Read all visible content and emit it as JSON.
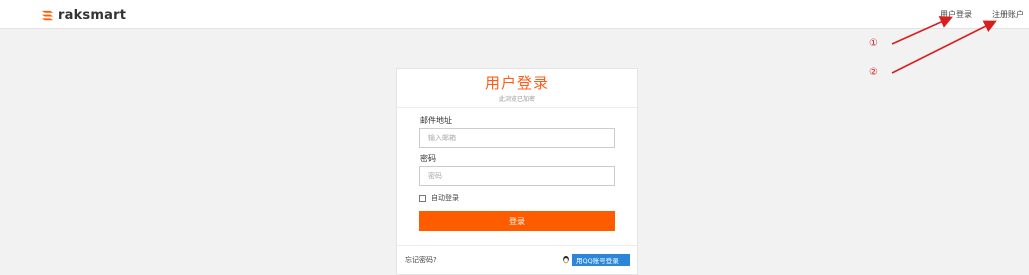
{
  "header": {
    "brand": "raksmart",
    "nav": {
      "login": "用户登录",
      "register": "注册账户"
    }
  },
  "annotations": {
    "marker1": "①",
    "marker2": "②"
  },
  "login_card": {
    "title": "用户登录",
    "subtitle": "此浏览已加密",
    "email_label": "邮件地址",
    "email_placeholder": "输入邮箱",
    "password_label": "密码",
    "password_placeholder": "密码",
    "remember_label": "自动登录",
    "submit_label": "登录",
    "forgot_label": "忘记密码?",
    "qq_login_label": "用QQ账号登录"
  },
  "colors": {
    "accent": "#ff5c00",
    "annotation": "#d62020",
    "qq_blue": "#2a86d8"
  }
}
